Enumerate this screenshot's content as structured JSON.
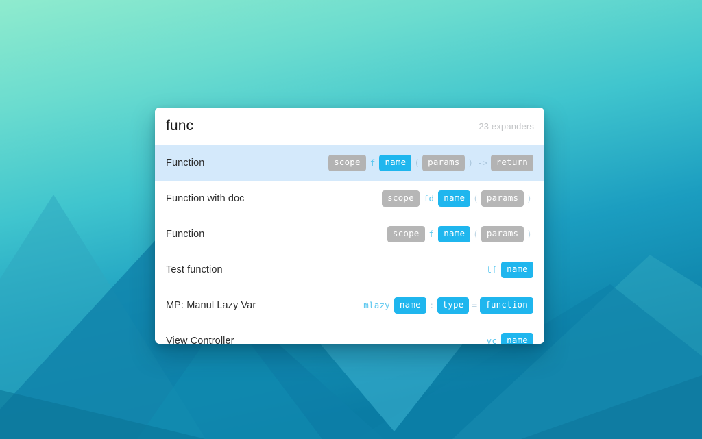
{
  "background": {
    "gradient_top": "#8FEBCE",
    "gradient_bottom": "#0A7CA4",
    "art": "mountain-polygons"
  },
  "panel": {
    "header": {
      "title": "func",
      "count_label": "23 expanders"
    },
    "rows": [
      {
        "label": "Function",
        "selected": true,
        "tokens": [
          {
            "text": "scope",
            "style": "chip-gray"
          },
          {
            "text": "f",
            "style": "plain"
          },
          {
            "text": "name",
            "style": "chip-blue"
          },
          {
            "text": "(",
            "style": "punct"
          },
          {
            "text": "params",
            "style": "chip-gray"
          },
          {
            "text": ")",
            "style": "punct"
          },
          {
            "text": "->",
            "style": "punct"
          },
          {
            "text": "return",
            "style": "chip-gray"
          }
        ]
      },
      {
        "label": "Function with doc",
        "selected": false,
        "tokens": [
          {
            "text": "scope",
            "style": "chip-gray"
          },
          {
            "text": "fd",
            "style": "plain"
          },
          {
            "text": "name",
            "style": "chip-blue"
          },
          {
            "text": "(",
            "style": "punct"
          },
          {
            "text": "params",
            "style": "chip-gray"
          },
          {
            "text": ")",
            "style": "punct"
          }
        ]
      },
      {
        "label": "Function",
        "selected": false,
        "tokens": [
          {
            "text": "scope",
            "style": "chip-gray"
          },
          {
            "text": "f",
            "style": "plain"
          },
          {
            "text": "name",
            "style": "chip-blue"
          },
          {
            "text": "(",
            "style": "punct"
          },
          {
            "text": "params",
            "style": "chip-gray"
          },
          {
            "text": ")",
            "style": "punct"
          }
        ]
      },
      {
        "label": "Test function",
        "selected": false,
        "tokens": [
          {
            "text": "tf",
            "style": "plain"
          },
          {
            "text": "name",
            "style": "chip-blue"
          }
        ]
      },
      {
        "label": "MP: Manul Lazy Var",
        "selected": false,
        "tokens": [
          {
            "text": "mlazy",
            "style": "plain"
          },
          {
            "text": "name",
            "style": "chip-blue"
          },
          {
            "text": ":",
            "style": "punct"
          },
          {
            "text": "type",
            "style": "chip-blue"
          },
          {
            "text": "=",
            "style": "punct"
          },
          {
            "text": "function",
            "style": "chip-blue"
          }
        ]
      },
      {
        "label": "View Controller",
        "selected": false,
        "tokens": [
          {
            "text": "vc",
            "style": "plain"
          },
          {
            "text": "name",
            "style": "chip-blue"
          }
        ]
      }
    ]
  },
  "colors": {
    "accent_blue": "#1fb6ee",
    "chip_gray": "#b6b6b6",
    "selected_row": "#d4e9fb",
    "panel_bg": "#ffffff",
    "title_text": "#1b1b1b",
    "count_text": "#c2c4c6"
  }
}
